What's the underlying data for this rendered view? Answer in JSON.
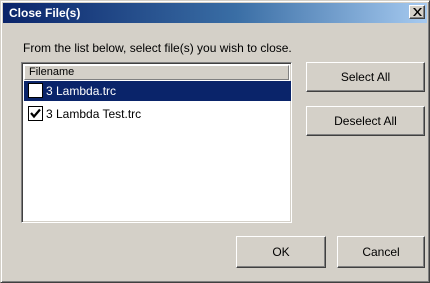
{
  "window": {
    "title": "Close File(s)"
  },
  "instruction": "From the list below, select file(s) you wish to close.",
  "list": {
    "header": "Filename",
    "items": [
      {
        "name": "3 Lambda.trc",
        "checked": false,
        "selected": true
      },
      {
        "name": "3 Lambda Test.trc",
        "checked": true,
        "selected": false
      }
    ]
  },
  "buttons": {
    "select_all": "Select All",
    "deselect_all": "Deselect All",
    "ok": "OK",
    "cancel": "Cancel"
  },
  "colors": {
    "title_bar": "#0a246a",
    "selection": "#0a246a",
    "face": "#d4d0c8"
  }
}
